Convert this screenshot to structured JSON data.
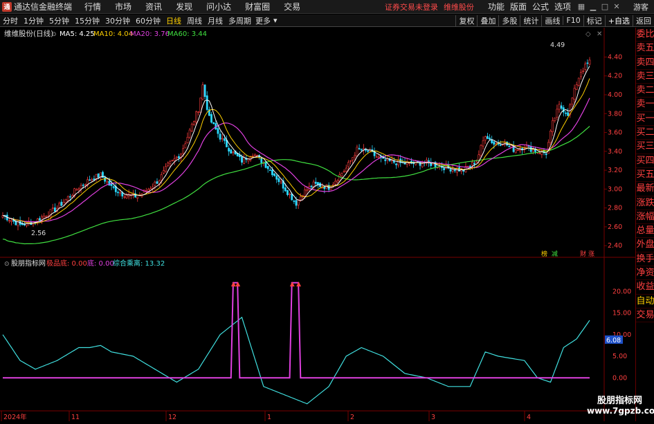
{
  "titlebar": {
    "app_name": "通达信金融终端",
    "menus": [
      "行情",
      "市场",
      "资讯",
      "发现",
      "问小达",
      "财富圈",
      "交易"
    ],
    "warning": "证券交易未登录",
    "stock": "维维股份",
    "right_menus": [
      "功能",
      "版面",
      "公式",
      "选项"
    ],
    "guest": "游客"
  },
  "toolbar": {
    "periods": [
      "分时",
      "1分钟",
      "5分钟",
      "15分钟",
      "30分钟",
      "60分钟",
      "日线",
      "周线",
      "月线",
      "多周期"
    ],
    "active_period": "日线",
    "more": "更多",
    "right_buttons": [
      "复权",
      "叠加",
      "多股",
      "统计",
      "画线",
      "F10",
      "标记",
      "+自选",
      "返回"
    ]
  },
  "chart_header": {
    "stock_label": "维维股份(日线)",
    "ma": [
      {
        "label": "MA5: 4.25",
        "color": "#ffffff"
      },
      {
        "label": "MA10: 4.04",
        "color": "#ffd000"
      },
      {
        "label": "MA20: 3.76",
        "color": "#e040e0"
      },
      {
        "label": "MA60: 3.44",
        "color": "#40e040"
      }
    ]
  },
  "price_axis": [
    "4.40",
    "4.20",
    "4.00",
    "3.80",
    "3.60",
    "3.40",
    "3.20",
    "3.00",
    "2.80",
    "2.60",
    "2.40"
  ],
  "price_annotations": {
    "high": "4.49",
    "low": "2.56"
  },
  "markers": [
    "榜",
    "减",
    "财",
    "涨"
  ],
  "indicator_header": {
    "name": "股朋指标网",
    "items": [
      {
        "label": "极品底: 0.00",
        "color": "#ff4040"
      },
      {
        "label": "底: 0.00",
        "color": "#e040e0"
      },
      {
        "label": "综合乘离: 13.32",
        "color": "#40e0e0"
      }
    ]
  },
  "indicator_axis": [
    "20.00",
    "15.00",
    "10.00",
    "5.00",
    "0.00"
  ],
  "indicator_current": "6.08",
  "date_axis": [
    "2024年",
    "11",
    "12",
    "1",
    "2",
    "3",
    "4"
  ],
  "right_panel": [
    "委比",
    "卖五",
    "卖四",
    "卖三",
    "卖二",
    "卖一",
    "买一",
    "买二",
    "买三",
    "买四",
    "买五",
    "最新",
    "涨跌",
    "涨幅",
    "总量",
    "外盘",
    "换手",
    "净资",
    "收益",
    "自动",
    "交易"
  ],
  "watermark": {
    "line1": "股朋指标网",
    "line2": "www.7gpzb.com"
  },
  "chart_data": {
    "type": "candlestick",
    "price_range": [
      2.35,
      4.55
    ],
    "indicator_range": [
      -7,
      25
    ],
    "ma5_last": 4.25,
    "ma10_last": 4.04,
    "ma20_last": 3.76,
    "ma60_last": 3.44,
    "indicator_value": 13.32
  },
  "colors": {
    "up": "#ff3c3c",
    "down": "#2bd9ff",
    "ma5": "#ffffff",
    "ma10": "#ffd000",
    "ma20": "#e040e0",
    "ma60": "#40e040",
    "indicator_line": "#40e0e0",
    "bottom_line": "#e040e0"
  }
}
